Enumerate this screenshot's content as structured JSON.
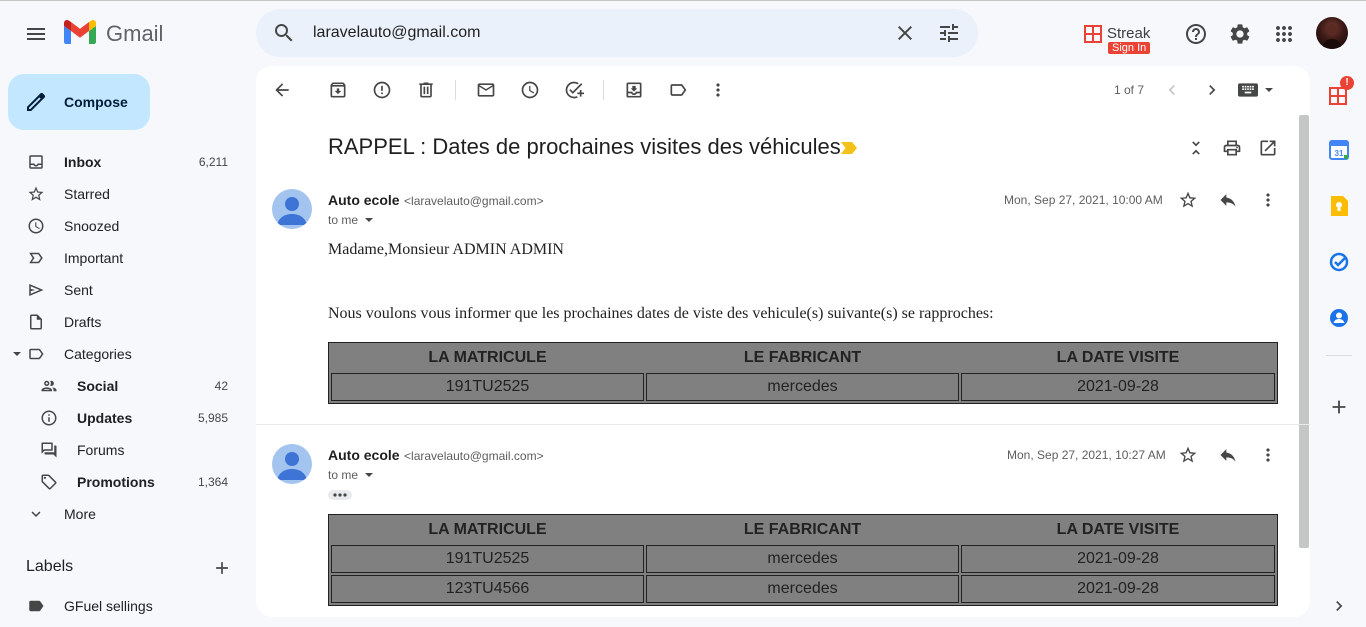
{
  "app": {
    "name": "Gmail"
  },
  "search": {
    "value": "laravelauto@gmail.com"
  },
  "streak": {
    "label": "Streak",
    "badge": "Sign In"
  },
  "compose": {
    "label": "Compose"
  },
  "nav": {
    "inbox": {
      "label": "Inbox",
      "count": "6,211"
    },
    "starred": {
      "label": "Starred"
    },
    "snoozed": {
      "label": "Snoozed"
    },
    "important": {
      "label": "Important"
    },
    "sent": {
      "label": "Sent"
    },
    "drafts": {
      "label": "Drafts"
    },
    "categories": {
      "label": "Categories"
    },
    "social": {
      "label": "Social",
      "count": "42"
    },
    "updates": {
      "label": "Updates",
      "count": "5,985"
    },
    "forums": {
      "label": "Forums"
    },
    "promotions": {
      "label": "Promotions",
      "count": "1,364"
    },
    "more": {
      "label": "More"
    }
  },
  "labels": {
    "title": "Labels",
    "items": [
      "GFuel sellings"
    ]
  },
  "toolbar": {
    "pagination": "1 of 7"
  },
  "thread": {
    "subject": "RAPPEL : Dates de prochaines visites des véhicules",
    "messages": [
      {
        "sender": "Auto ecole",
        "email": "<laravelauto@gmail.com>",
        "to": "to me",
        "date": "Mon, Sep 27, 2021, 10:00 AM",
        "greeting": "Madame,Monsieur ADMIN ADMIN",
        "body": "Nous voulons vous informer que les prochaines dates de viste des vehicule(s) suivante(s) se rapproches:",
        "table": {
          "headers": [
            "LA MATRICULE",
            "LE FABRICANT",
            "LA DATE VISITE"
          ],
          "rows": [
            [
              "191TU2525",
              "mercedes",
              "2021-09-28"
            ]
          ]
        }
      },
      {
        "sender": "Auto ecole",
        "email": "<laravelauto@gmail.com>",
        "to": "to me",
        "date": "Mon, Sep 27, 2021, 10:27 AM",
        "table": {
          "headers": [
            "LA MATRICULE",
            "LE FABRICANT",
            "LA DATE VISITE"
          ],
          "rows": [
            [
              "191TU2525",
              "mercedes",
              "2021-09-28"
            ],
            [
              "123TU4566",
              "mercedes",
              "2021-09-28"
            ]
          ]
        }
      }
    ]
  },
  "side_panel": {
    "notification_badge": "!",
    "calendar_day": "31"
  },
  "colors": {
    "compose_bg": "#c2e7ff",
    "search_bg": "#eaf1fb",
    "page_bg": "#f6f8fc",
    "table_bg": "#808080",
    "streak_orange": "#ea4335"
  }
}
